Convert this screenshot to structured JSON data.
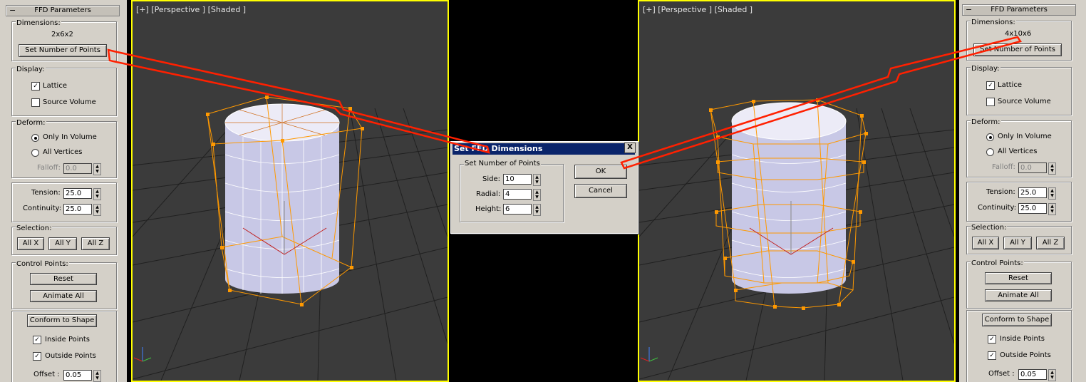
{
  "left_panel": {
    "rollout_title": "FFD Parameters",
    "dimensions_label": "Dimensions:",
    "dimensions_value": "2x6x2",
    "set_points_button": "Set Number of Points",
    "display_label": "Display:",
    "lattice_label": "Lattice",
    "lattice_checked": true,
    "source_volume_label": "Source Volume",
    "source_volume_checked": false,
    "deform_label": "Deform:",
    "only_in_volume_label": "Only In Volume",
    "all_vertices_label": "All Vertices",
    "falloff_label": "Falloff:",
    "falloff_value": "0.0",
    "tension_label": "Tension:",
    "tension_value": "25.0",
    "continuity_label": "Continuity:",
    "continuity_value": "25.0",
    "selection_label": "Selection:",
    "all_x": "All X",
    "all_y": "All Y",
    "all_z": "All Z",
    "control_points_label": "Control Points:",
    "reset": "Reset",
    "animate_all": "Animate All",
    "conform_to_shape": "Conform to Shape",
    "inside_points_label": "Inside Points",
    "inside_points_checked": true,
    "outside_points_label": "Outside Points",
    "outside_points_checked": true,
    "offset_label": "Offset :",
    "offset_value": "0.05"
  },
  "right_panel": {
    "rollout_title": "FFD Parameters",
    "dimensions_label": "Dimensions:",
    "dimensions_value": "4x10x6",
    "set_points_button": "Set Number of Points",
    "display_label": "Display:",
    "lattice_label": "Lattice",
    "lattice_checked": true,
    "source_volume_label": "Source Volume",
    "source_volume_checked": false,
    "deform_label": "Deform:",
    "only_in_volume_label": "Only In Volume",
    "all_vertices_label": "All Vertices",
    "falloff_label": "Falloff:",
    "falloff_value": "0.0",
    "tension_label": "Tension:",
    "tension_value": "25.0",
    "continuity_label": "Continuity:",
    "continuity_value": "25.0",
    "selection_label": "Selection:",
    "all_x": "All X",
    "all_y": "All Y",
    "all_z": "All Z",
    "control_points_label": "Control Points:",
    "reset": "Reset",
    "animate_all": "Animate All",
    "conform_to_shape": "Conform to Shape",
    "inside_points_label": "Inside Points",
    "inside_points_checked": true,
    "outside_points_label": "Outside Points",
    "outside_points_checked": true,
    "offset_label": "Offset :",
    "offset_value": "0.05"
  },
  "left_viewport": {
    "label": "[+] [Perspective ] [Shaded ]"
  },
  "right_viewport": {
    "label": "[+] [Perspective ] [Shaded ]"
  },
  "dialog": {
    "title": "Set FFD Dimensions",
    "group_label": "Set Number of Points",
    "side_label": "Side:",
    "side_value": "10",
    "radial_label": "Radial:",
    "radial_value": "4",
    "height_label": "Height:",
    "height_value": "6",
    "ok": "OK",
    "cancel": "Cancel",
    "close": "X"
  },
  "colors": {
    "panel_bg": "#d4d0c8",
    "viewport_bg": "#3b3b3b",
    "active_border": "#ffff00",
    "lattice": "#ff9900",
    "cylinder": "#dcdcf0",
    "annotation_arrow": "#ff2000",
    "dialog_title_bg": "#0a246a"
  }
}
